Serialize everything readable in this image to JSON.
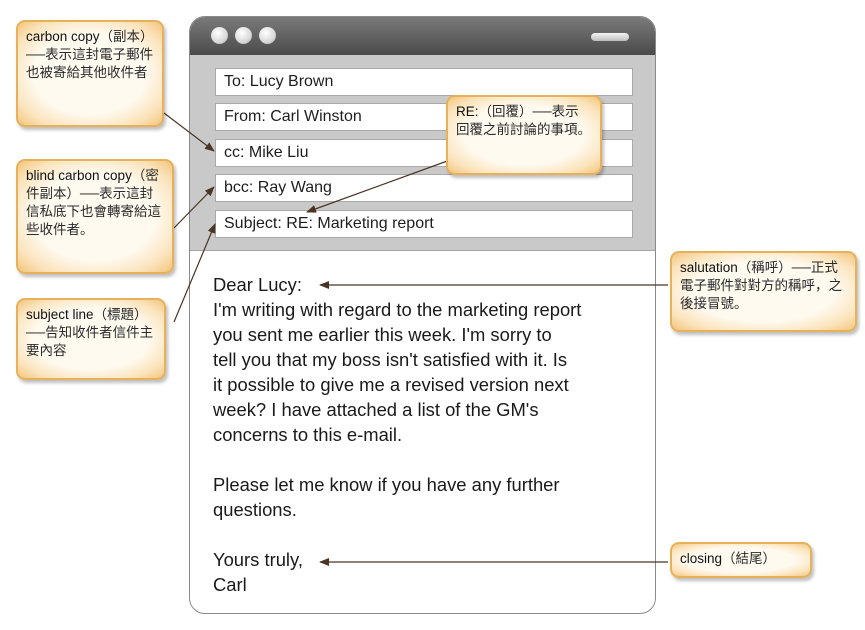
{
  "email": {
    "to": "To: Lucy Brown",
    "from": "From: Carl Winston",
    "cc": "cc: Mike Liu",
    "bcc": "bcc: Ray Wang",
    "subject": "Subject: RE: Marketing report",
    "salutation": "Dear Lucy:",
    "body": "I'm writing with regard to the marketing report\nyou sent me earlier this week. I'm sorry to\ntell you that my boss isn't satisfied with it. Is\nit possible to give me a revised version next\nweek? I have attached a list of the GM's\nconcerns to this e-mail.",
    "followup": "Please let me know if you have any further\nquestions.",
    "closing": "Yours truly,",
    "signature": "Carl"
  },
  "annotations": {
    "carbon_copy": {
      "term": "carbon copy",
      "text": "（副本）──表示這封電子郵件也被寄給其他收件者"
    },
    "re": {
      "term": "RE:",
      "text": "（回覆）──表示回覆之前討論的事項。"
    },
    "blind_carbon_copy": {
      "term": "blind carbon copy",
      "text": "（密件副本）──表示這封信私底下也會轉寄給這些收件者。"
    },
    "subject_line": {
      "term": "subject line",
      "text": "（標題）──告知收件者信件主要內容"
    },
    "salutation": {
      "term": "salutation",
      "text": "（稱呼）──正式電子郵件對對方的稱呼，之後接冒號。"
    },
    "closing": {
      "term": "closing",
      "text": "（結尾）"
    }
  },
  "colors": {
    "callout_border": "#e7b15c",
    "leader_line": "#4a3424",
    "titlebar": "#5a5a5a",
    "header_panel": "#c9c9c9"
  }
}
